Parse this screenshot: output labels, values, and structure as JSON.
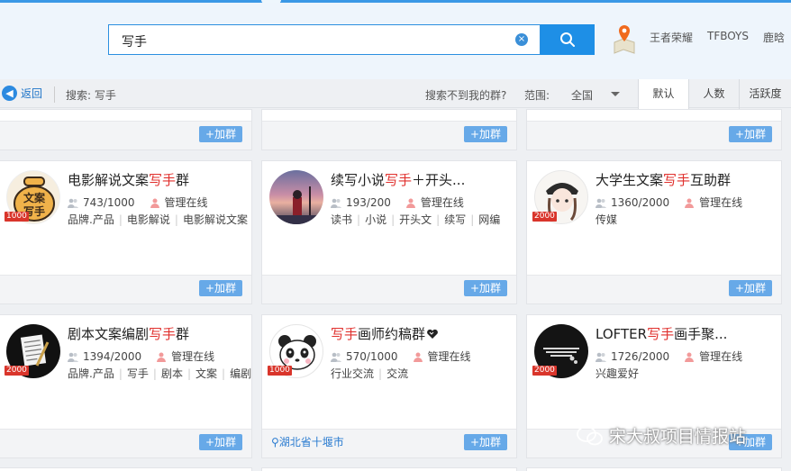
{
  "header": {
    "search_value": "写手",
    "clear_icon": "×",
    "hot_tags": [
      "王者荣耀",
      "TFBOYS",
      "鹿晗"
    ]
  },
  "toolbar": {
    "back_label": "返回",
    "search_label": "搜索: 写手",
    "notfound_label": "搜索不到我的群?",
    "range_label": "范围:",
    "range_value": "全国",
    "sort_tabs": [
      "默认",
      "人数",
      "活跃度"
    ]
  },
  "join_label": "+加群",
  "admin_label": "管理在线",
  "cards": [
    {
      "title_pre": "电影解说文案",
      "title_hl": "写手",
      "title_post": "群",
      "count": "743/1000",
      "badge": "1000",
      "tags": [
        "品牌.产品",
        "电影解说",
        "电影解说文案"
      ]
    },
    {
      "title_pre": "续写小说",
      "title_hl": "写手",
      "title_post": "＋开头...",
      "count": "193/200",
      "badge": "",
      "tags": [
        "读书",
        "小说",
        "开头文",
        "续写",
        "网编"
      ]
    },
    {
      "title_pre": "大学生文案",
      "title_hl": "写手",
      "title_post": "互助群",
      "count": "1360/2000",
      "badge": "2000",
      "tags": [
        "传媒"
      ]
    },
    {
      "title_pre": "剧本文案编剧",
      "title_hl": "写手",
      "title_post": "群",
      "count": "1394/2000",
      "badge": "2000",
      "tags": [
        "品牌.产品",
        "写手",
        "剧本",
        "文案",
        "编剧"
      ]
    },
    {
      "title_pre": "",
      "title_hl": "写手",
      "title_post": "画师约稿群",
      "count": "570/1000",
      "badge": "1000",
      "tags": [
        "行业交流",
        "交流"
      ],
      "location": "湖北省十堰市"
    },
    {
      "title_pre": "LOFTER",
      "title_hl": "写手",
      "title_post": "画手聚...",
      "count": "1726/2000",
      "badge": "2000",
      "tags": [
        "兴趣爱好"
      ]
    }
  ],
  "avatar_text": {
    "card0": [
      "文案",
      "写手"
    ]
  },
  "watermark": "宋大叔项目情报站",
  "colors": {
    "accent": "#1e8fe6",
    "highlight": "#e0302d",
    "join": "#67a9e8",
    "badge": "#d9352b"
  }
}
